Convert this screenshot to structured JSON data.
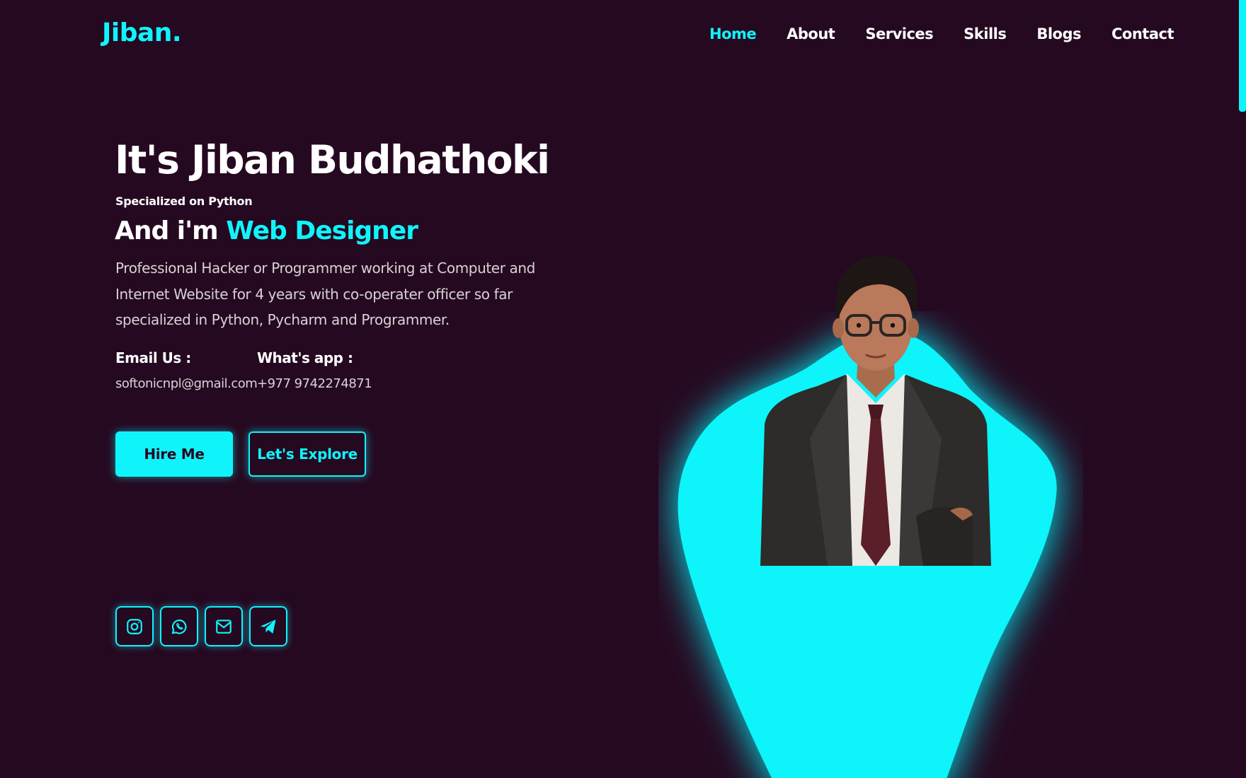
{
  "header": {
    "logo": "Jiban.",
    "nav": [
      {
        "label": "Home",
        "active": true
      },
      {
        "label": "About"
      },
      {
        "label": "Services"
      },
      {
        "label": "Skills"
      },
      {
        "label": "Blogs"
      },
      {
        "label": "Contact"
      }
    ]
  },
  "hero": {
    "title": "It's Jiban Budhathoki",
    "subtitle": "Specialized on Python",
    "role_prefix": "And i'm ",
    "role_accent": "Web Designer",
    "description": "Professional Hacker or Programmer working at Computer and Internet Website for 4 years with co-operater officer so far specialized in Python, Pycharm and Programmer.",
    "email_label": "Email Us :",
    "email_value": "softonicnpl@gmail.com",
    "whatsapp_label": "What's app :",
    "whatsapp_value": "+977 9742274871",
    "hire_button": "Hire Me",
    "explore_button": "Let's Explore"
  },
  "social": [
    {
      "icon": "instagram-icon"
    },
    {
      "icon": "whatsapp-icon"
    },
    {
      "icon": "mail-icon"
    },
    {
      "icon": "telegram-icon"
    }
  ],
  "colors": {
    "background": "#250921",
    "accent": "#0ff4fb",
    "text": "#ffffff",
    "muted_text": "#d9d2d6"
  }
}
